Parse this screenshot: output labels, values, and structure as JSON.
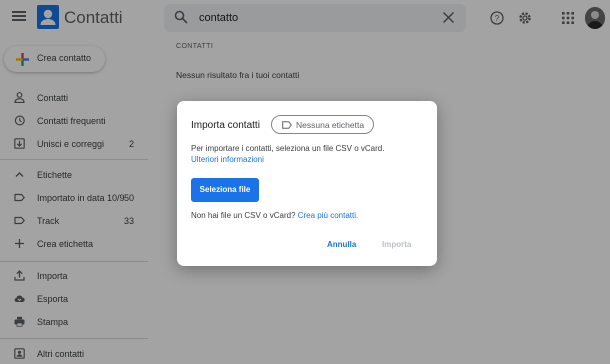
{
  "header": {
    "app_title": "Contatti",
    "search": {
      "value": "contatto",
      "placeholder": ""
    }
  },
  "sidebar": {
    "create_button": "Crea contatto",
    "items": [
      {
        "label": "Contatti",
        "icon": "person-icon",
        "count": ""
      },
      {
        "label": "Contatti frequenti",
        "icon": "history-icon",
        "count": ""
      },
      {
        "label": "Unisci e correggi",
        "icon": "merge-icon",
        "count": "2"
      }
    ],
    "labels_section": {
      "label": "Etichette",
      "icon": "chevron-up-icon"
    },
    "labels": [
      {
        "label": "Importato in data 10/9",
        "icon": "label-icon",
        "count": "50"
      },
      {
        "label": "Track",
        "icon": "label-icon",
        "count": "33"
      },
      {
        "label": "Crea etichetta",
        "icon": "add-icon",
        "count": ""
      }
    ],
    "tools": [
      {
        "label": "Importa",
        "icon": "upload-icon"
      },
      {
        "label": "Esporta",
        "icon": "cloud-download-icon"
      },
      {
        "label": "Stampa",
        "icon": "print-icon"
      }
    ],
    "other": {
      "label": "Altri contatti",
      "icon": "contacts-icon"
    }
  },
  "main": {
    "section_header": "CONTATTI",
    "no_results": "Nessun risultato fra i tuoi contatti"
  },
  "dialog": {
    "title": "Importa contatti",
    "chip_label": "Nessuna etichetta",
    "description": "Per importare i contatti, seleziona un file CSV o vCard.",
    "more_info_link": "Ulteriori informazioni",
    "select_file_button": "Seleziona file",
    "no_file_text": "Non hai file un CSV o vCard?",
    "create_contacts_link": "Crea più contatti.",
    "cancel_button": "Annulla",
    "import_button": "Importa"
  },
  "colors": {
    "accent": "#1a73e8",
    "scrim": "rgba(0,0,0,0.36)",
    "text_secondary": "#5f6368"
  }
}
